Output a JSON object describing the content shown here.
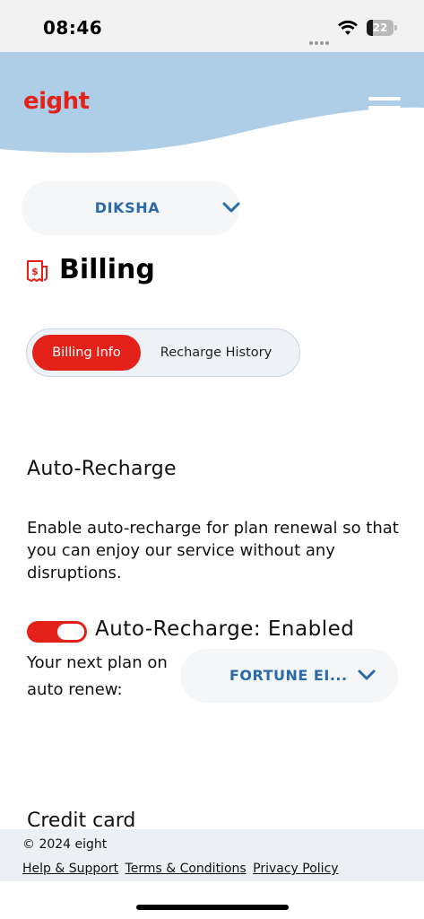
{
  "status_bar": {
    "time": "08:46",
    "battery": "22",
    "battery_level": 0.22
  },
  "header": {
    "logo_text": "eight",
    "brand_color": "#e32119",
    "header_color": "#aecde6"
  },
  "profile_selector": {
    "selected": "DIKSHA"
  },
  "page": {
    "title": "Billing",
    "title_icon": "billing-icon"
  },
  "tabs": [
    {
      "label": "Billing Info",
      "active": true
    },
    {
      "label": "Recharge History",
      "active": false
    }
  ],
  "auto_recharge": {
    "title": "Auto-Recharge",
    "description": "Enable auto-recharge for plan renewal so that you can enjoy our service without any disruptions.",
    "toggle_on": true,
    "status_label": "Auto-Recharge: Enabled",
    "next_plan_label": "Your next plan on auto renew:",
    "plan_selected": "FORTUNE EI..."
  },
  "credit_card": {
    "title": "Credit card"
  },
  "footer": {
    "copyright": "© 2024 eight",
    "links": [
      "Help & Support",
      "Terms & Conditions",
      "Privacy Policy"
    ]
  },
  "colors": {
    "accent": "#e32119",
    "link_blue": "#2a6aa8",
    "pill_bg": "#f5f6f8",
    "footer_bg": "#eceff3"
  }
}
